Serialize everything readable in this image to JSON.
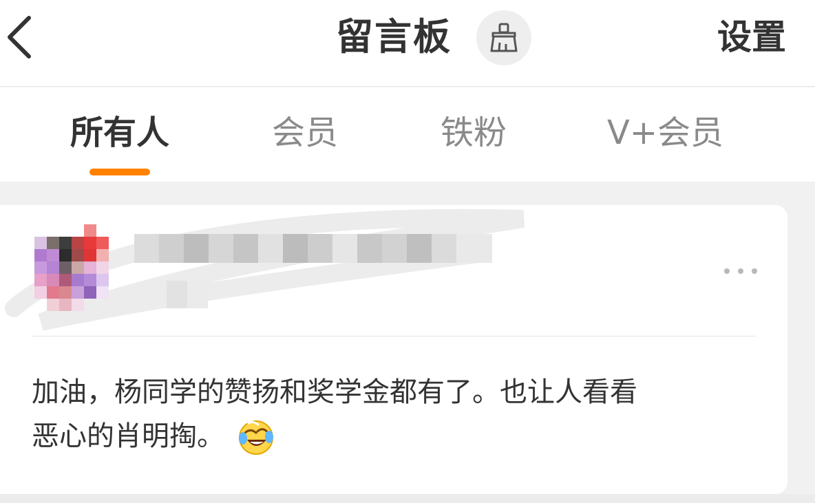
{
  "header": {
    "back_icon": "chevron-left-icon",
    "title": "留言板",
    "clean_icon": "broom-icon",
    "settings_label": "设置"
  },
  "tabs": [
    {
      "label": "所有人",
      "active": true
    },
    {
      "label": "会员",
      "active": false
    },
    {
      "label": "铁粉",
      "active": false
    },
    {
      "label": "V+会员",
      "active": false
    }
  ],
  "colors": {
    "accent": "#ff8200",
    "text_primary": "#333333",
    "text_secondary": "#8a8a8a",
    "background": "#f1f1f1"
  },
  "post": {
    "more_icon": "more-dots-icon",
    "message_line1": "加油，杨同学的赞扬和奖学金都有了。也让人看看",
    "message_line2": "恶心的肖明掏。",
    "emoji": "laugh-cry-emoji-icon"
  }
}
